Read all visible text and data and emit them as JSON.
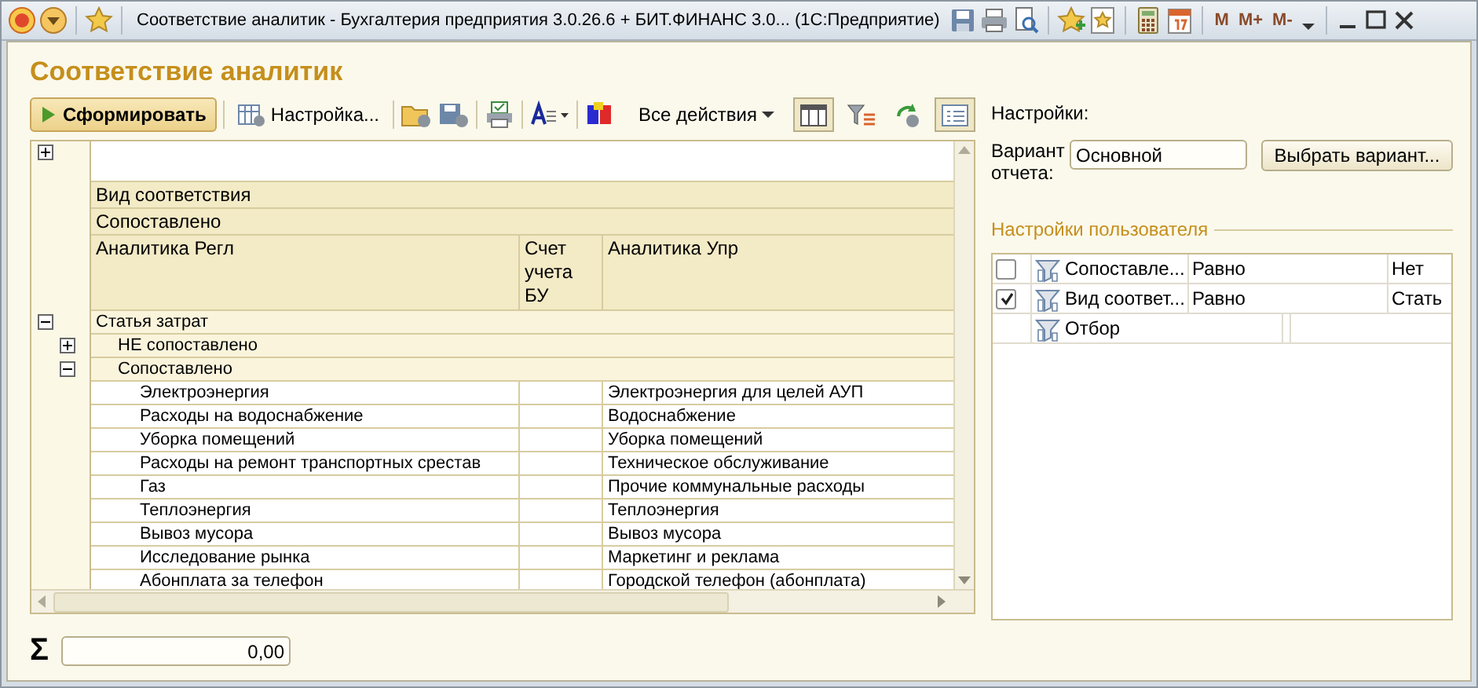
{
  "window": {
    "title": "Соответствие аналитик - Бухгалтерия предприятия 3.0.26.6 + БИТ.ФИНАНС 3.0...  (1С:Предприятие)",
    "memory_buttons": [
      "M",
      "M+",
      "M-"
    ]
  },
  "form": {
    "title": "Соответствие аналитик"
  },
  "toolbar": {
    "generate": "Сформировать",
    "settings": "Настройка...",
    "all_actions": "Все действия",
    "toggles": [
      {
        "kind": "layout",
        "selected": true
      },
      {
        "kind": "filter",
        "selected": false
      },
      {
        "kind": "refresh",
        "selected": false
      },
      {
        "kind": "panel",
        "selected": true
      }
    ]
  },
  "report": {
    "header_rows": [
      "Вид соответствия",
      "Сопоставлено"
    ],
    "columns": [
      "Аналитика Регл",
      "Счет учета БУ",
      "Аналитика Упр"
    ],
    "tree": [
      {
        "label": "Статья затрат",
        "expanded": true,
        "children": [
          {
            "label": "НЕ сопоставлено",
            "expanded": false
          },
          {
            "label": "Сопоставлено",
            "expanded": true,
            "rows": [
              {
                "regl": "Электроэнергия",
                "upr": "Электроэнергия для целей АУП"
              },
              {
                "regl": "Расходы на водоснабжение",
                "upr": "Водоснабжение"
              },
              {
                "regl": "Уборка помещений",
                "upr": "Уборка помещений"
              },
              {
                "regl": "Расходы на ремонт транспортных срестав",
                "upr": "Техническое обслуживание"
              },
              {
                "regl": "Газ",
                "upr": "Прочие коммунальные расходы"
              },
              {
                "regl": "Теплоэнергия",
                "upr": "Теплоэнергия"
              },
              {
                "regl": "Вывоз мусора",
                "upr": "Вывоз мусора"
              },
              {
                "regl": "Исследование рынка",
                "upr": "Маркетинг и реклама"
              },
              {
                "regl": "Абонплата за телефон",
                "upr": "Городской телефон (абонплата)"
              }
            ]
          }
        ]
      }
    ]
  },
  "total": {
    "label": "Σ",
    "value": "0,00"
  },
  "settings": {
    "title": "Настройки:",
    "variant_label": "Вариант отчета:",
    "variant": "Основной",
    "choose_button": "Выбрать вариант...",
    "user_settings_title": "Настройки пользователя",
    "items": [
      {
        "kind": "condition",
        "checked": false,
        "field": "Сопоставле...",
        "comparison": "Равно",
        "value": "Нет"
      },
      {
        "kind": "condition",
        "checked": true,
        "field": "Вид соответ...",
        "comparison": "Равно",
        "value": "Стать"
      },
      {
        "kind": "group",
        "field": "Отбор"
      }
    ]
  }
}
